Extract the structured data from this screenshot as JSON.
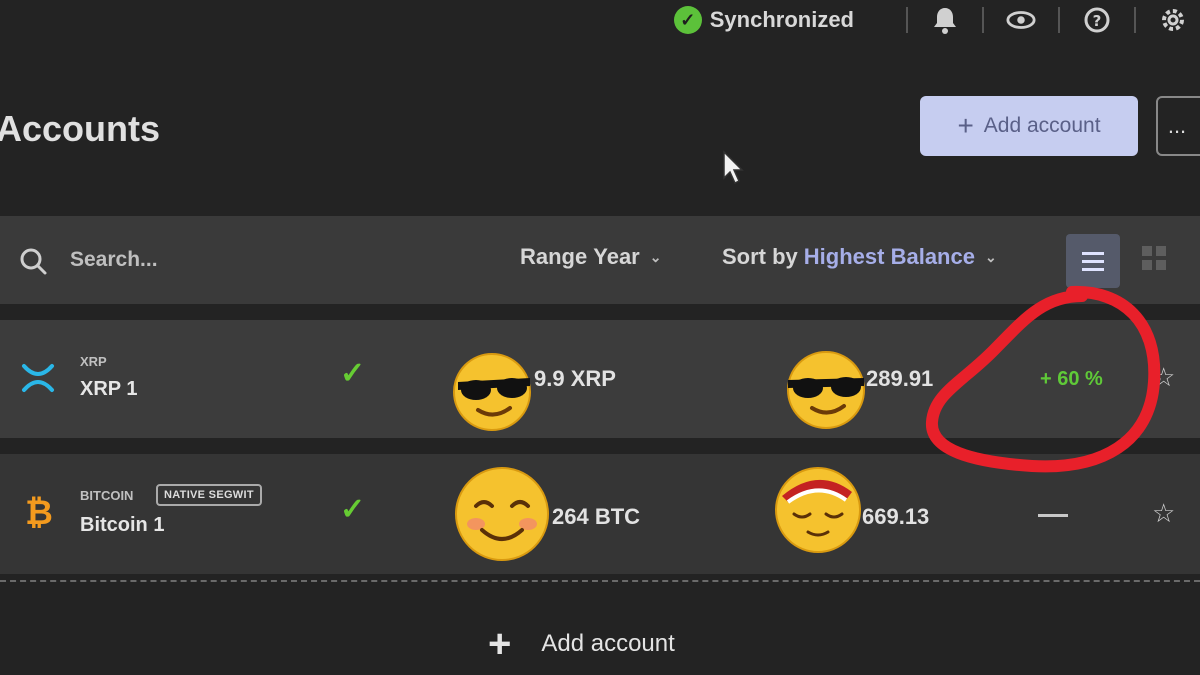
{
  "topbar": {
    "sync_label": "Synchronized",
    "icons": [
      "check-circle-icon",
      "bell-icon",
      "eye-icon",
      "help-icon",
      "gear-icon"
    ]
  },
  "header": {
    "title": "Accounts",
    "add_account_label": "Add account",
    "more_label": "..."
  },
  "toolbar": {
    "search_placeholder": "Search...",
    "range_label": "Range",
    "range_value": "Year",
    "sort_label": "Sort by",
    "sort_value": "Highest Balance",
    "view_modes": [
      "list",
      "grid"
    ],
    "active_view": "list"
  },
  "accounts": [
    {
      "ticker": "XRP",
      "name": "XRP 1",
      "badge": "",
      "synced": true,
      "balance": "9.9 XRP",
      "countervalue": "289.91",
      "change": "+ 60 %",
      "icon": "xrp-icon",
      "accent": "#2ab7e8"
    },
    {
      "ticker": "BITCOIN",
      "name": "Bitcoin 1",
      "badge": "NATIVE SEGWIT",
      "synced": true,
      "balance": "264 BTC",
      "countervalue": "669.13",
      "change": "",
      "icon": "bitcoin-icon",
      "accent": "#f39a1e"
    }
  ],
  "footer": {
    "add_account_label": "Add account"
  },
  "colors": {
    "background": "#232323",
    "accent_button": "#c6cdf0",
    "positive": "#5fc938",
    "annotation": "#e8202a"
  }
}
